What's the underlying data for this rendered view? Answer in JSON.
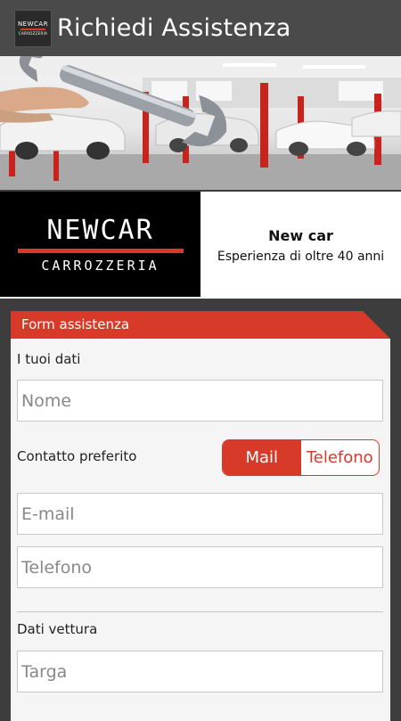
{
  "appbar": {
    "title": "Richiedi Assistenza",
    "icon_logo_top": "NEWCAR",
    "icon_logo_bottom": "CARROZZERIA"
  },
  "brand": {
    "logo_top": "NEWCAR",
    "logo_bottom": "CARROZZERIA",
    "name": "New car",
    "subtitle": "Esperienza di oltre 40 anni"
  },
  "form": {
    "header": "Form assistenza",
    "section_personal": "I tuoi dati",
    "name_placeholder": "Nome",
    "contact_label": "Contatto preferito",
    "contact_options": [
      "Mail",
      "Telefono"
    ],
    "contact_selected": "Mail",
    "email_placeholder": "E-mail",
    "phone_placeholder": "Telefono",
    "section_vehicle": "Dati vettura",
    "plate_placeholder": "Targa"
  },
  "colors": {
    "accent": "#d83a2a",
    "appbar": "#4a4a4a",
    "background": "#3d3d3d"
  }
}
